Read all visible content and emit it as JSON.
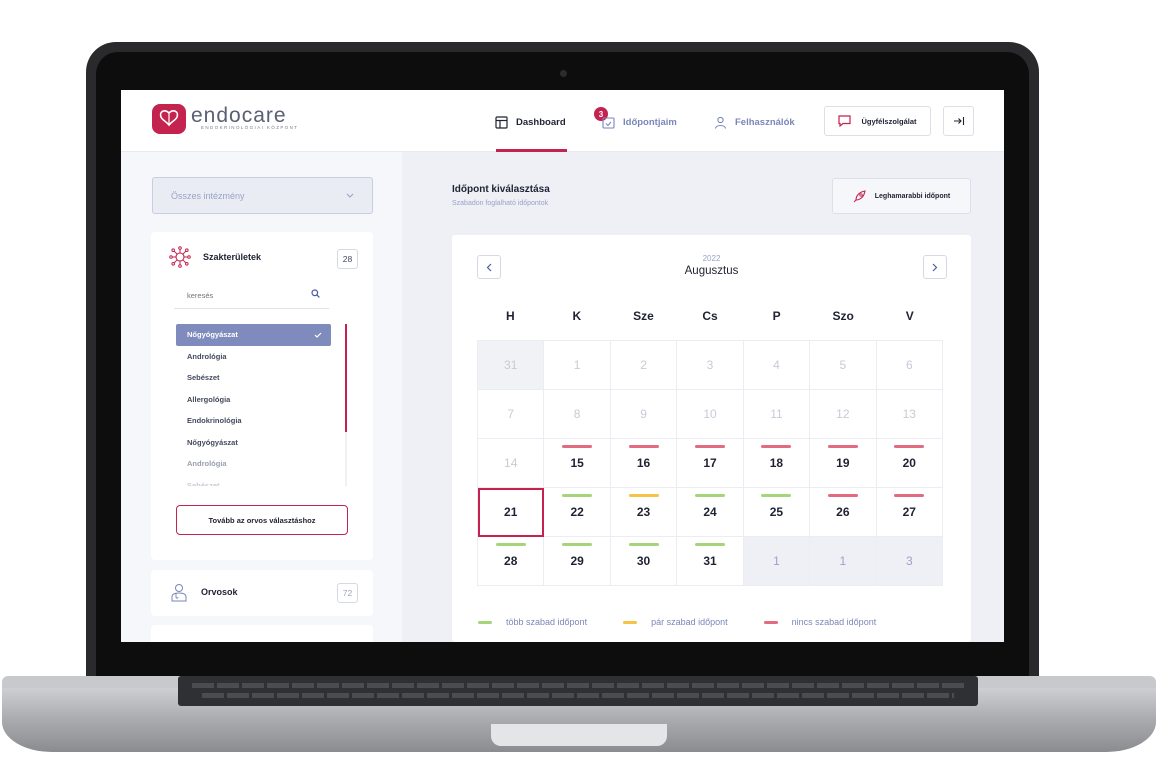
{
  "colors": {
    "accent": "#c4224f",
    "many_free": "#a6d47a",
    "few_free": "#f6c445",
    "none_free": "#e36b7f"
  },
  "logo": {
    "name": "endocare",
    "tagline": "ENDOKRINOLÓGIAI KÖZPONT"
  },
  "nav": {
    "dashboard": "Dashboard",
    "appointments": "Időpontjaim",
    "appointments_badge": "3",
    "users": "Felhasználók",
    "support": "Ügyfélszolgálat",
    "logout_icon": "logout-icon"
  },
  "sidebar": {
    "institution_select": "Összes intézmény",
    "specialties": {
      "title": "Szakterületek",
      "count": "28",
      "search_placeholder": "keresés",
      "items": [
        "Nőgyógyászat",
        "Andrológia",
        "Sebészet",
        "Allergológia",
        "Endokrinológia",
        "Nőgyógyászat",
        "Andrológia",
        "Sebészet"
      ],
      "selected": "Nőgyógyászat",
      "next_button": "Tovább az orvos választáshoz"
    },
    "doctors": {
      "title": "Orvosok",
      "count": "72"
    }
  },
  "main": {
    "title": "Időpont kiválasztása",
    "subtitle": "Szabadon foglalható időpontok",
    "earliest_button": "Leghamarabbi időpont"
  },
  "calendar": {
    "year": "2022",
    "month": "Augusztus",
    "weekdays": [
      "H",
      "K",
      "Sze",
      "Cs",
      "P",
      "Szo",
      "V"
    ],
    "weeks": [
      [
        {
          "d": "31",
          "s": "prev"
        },
        {
          "d": "1",
          "s": "past"
        },
        {
          "d": "2",
          "s": "past"
        },
        {
          "d": "3",
          "s": "past"
        },
        {
          "d": "4",
          "s": "past"
        },
        {
          "d": "5",
          "s": "past"
        },
        {
          "d": "6",
          "s": "past"
        }
      ],
      [
        {
          "d": "7",
          "s": "past"
        },
        {
          "d": "8",
          "s": "past"
        },
        {
          "d": "9",
          "s": "past"
        },
        {
          "d": "10",
          "s": "past"
        },
        {
          "d": "11",
          "s": "past"
        },
        {
          "d": "12",
          "s": "past"
        },
        {
          "d": "13",
          "s": "past"
        }
      ],
      [
        {
          "d": "14",
          "s": "past"
        },
        {
          "d": "15",
          "s": "none"
        },
        {
          "d": "16",
          "s": "none"
        },
        {
          "d": "17",
          "s": "none"
        },
        {
          "d": "18",
          "s": "none"
        },
        {
          "d": "19",
          "s": "none"
        },
        {
          "d": "20",
          "s": "none"
        }
      ],
      [
        {
          "d": "21",
          "s": "selected"
        },
        {
          "d": "22",
          "s": "many"
        },
        {
          "d": "23",
          "s": "few"
        },
        {
          "d": "24",
          "s": "many"
        },
        {
          "d": "25",
          "s": "many"
        },
        {
          "d": "26",
          "s": "none"
        },
        {
          "d": "27",
          "s": "none"
        }
      ],
      [
        {
          "d": "28",
          "s": "many"
        },
        {
          "d": "29",
          "s": "many"
        },
        {
          "d": "30",
          "s": "many"
        },
        {
          "d": "31",
          "s": "many"
        },
        {
          "d": "1",
          "s": "next"
        },
        {
          "d": "1",
          "s": "next"
        },
        {
          "d": "3",
          "s": "next"
        }
      ]
    ],
    "legend": {
      "many": "több szabad időpont",
      "few": "pár szabad időpont",
      "none": "nincs szabad időpont"
    }
  }
}
